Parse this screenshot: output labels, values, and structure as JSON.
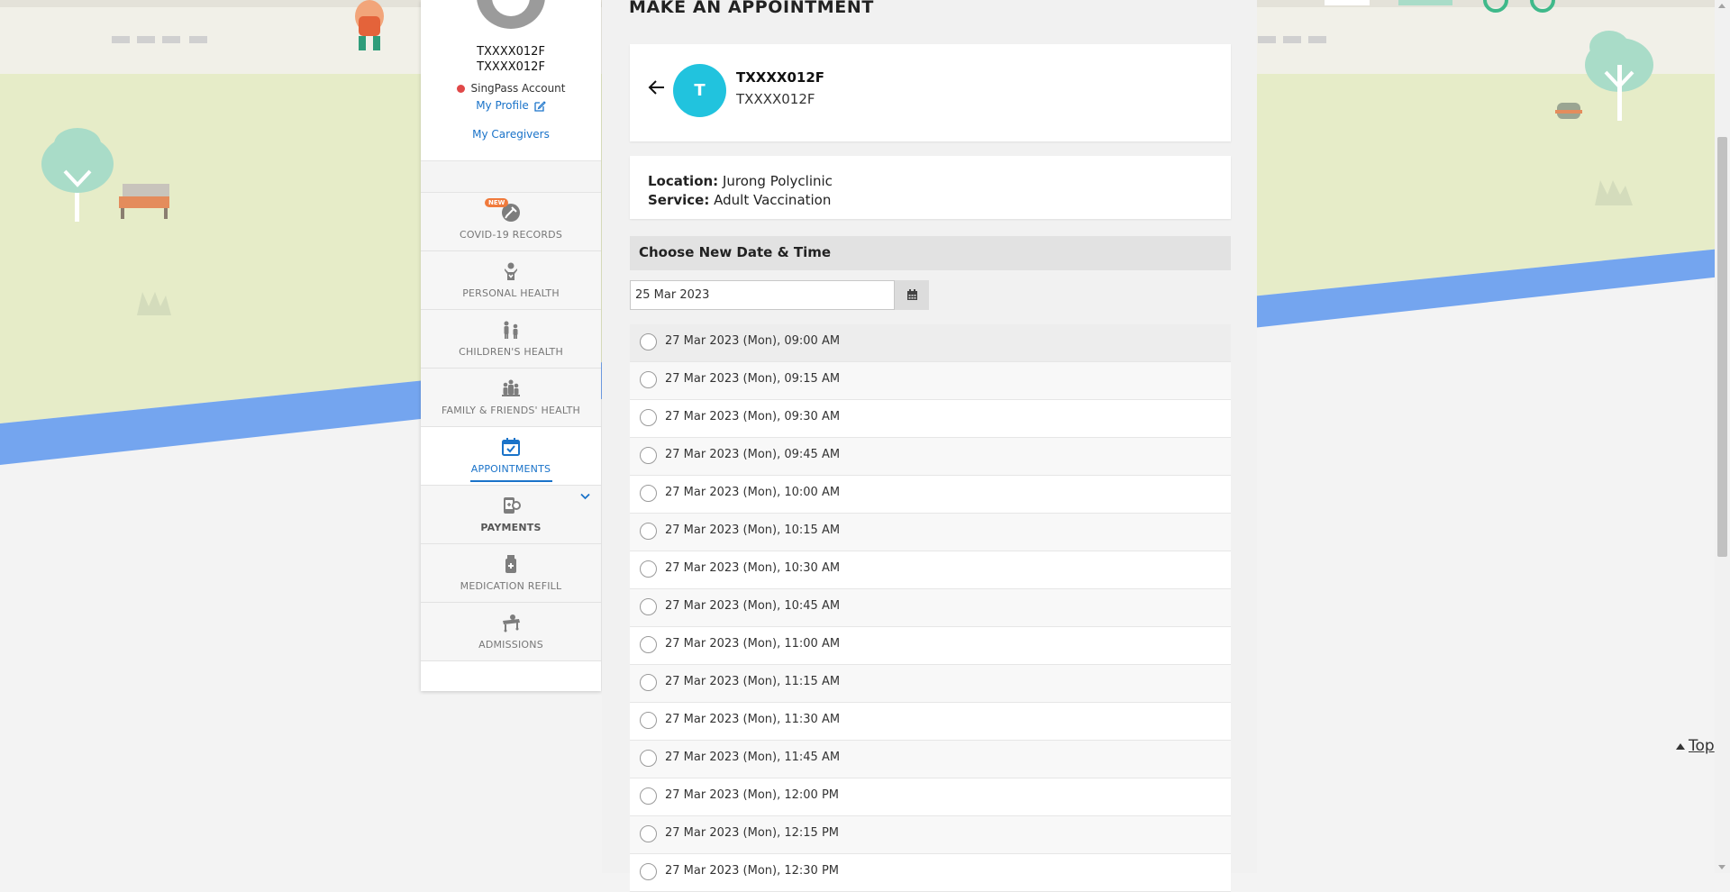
{
  "profile": {
    "id_line1": "TXXXX012F",
    "id_line2": "TXXXX012F",
    "account_type": "SingPass Account",
    "my_profile": "My Profile",
    "my_caregivers": "My Caregivers"
  },
  "nav": {
    "items": [
      {
        "label": "COVID-19 RECORDS",
        "icon": "syringe-shield-icon",
        "badge": "NEW"
      },
      {
        "label": "PERSONAL HEALTH",
        "icon": "person-heart-icon"
      },
      {
        "label": "CHILDREN'S HEALTH",
        "icon": "children-icon"
      },
      {
        "label": "FAMILY & FRIENDS' HEALTH",
        "icon": "family-icon"
      },
      {
        "label": "APPOINTMENTS",
        "icon": "calendar-check-icon",
        "active": true
      },
      {
        "label": "PAYMENTS",
        "icon": "payment-icon",
        "expandable": true
      },
      {
        "label": "MEDICATION REFILL",
        "icon": "medicine-bottle-icon"
      },
      {
        "label": "ADMISSIONS",
        "icon": "hospital-bed-icon"
      }
    ]
  },
  "main": {
    "title": "MAKE AN APPOINTMENT",
    "patient": {
      "initial": "T",
      "name": "TXXXX012F",
      "id": "TXXXX012F"
    },
    "info": {
      "location_label": "Location:",
      "location_value": "Jurong Polyclinic",
      "service_label": "Service:",
      "service_value": "Adult Vaccination"
    },
    "section_header": "Choose New Date & Time",
    "date_value": "25 Mar 2023",
    "slots": [
      "27 Mar 2023 (Mon), 09:00 AM",
      "27 Mar 2023 (Mon), 09:15 AM",
      "27 Mar 2023 (Mon), 09:30 AM",
      "27 Mar 2023 (Mon), 09:45 AM",
      "27 Mar 2023 (Mon), 10:00 AM",
      "27 Mar 2023 (Mon), 10:15 AM",
      "27 Mar 2023 (Mon), 10:30 AM",
      "27 Mar 2023 (Mon), 10:45 AM",
      "27 Mar 2023 (Mon), 11:00 AM",
      "27 Mar 2023 (Mon), 11:15 AM",
      "27 Mar 2023 (Mon), 11:30 AM",
      "27 Mar 2023 (Mon), 11:45 AM",
      "27 Mar 2023 (Mon), 12:00 PM",
      "27 Mar 2023 (Mon), 12:15 PM",
      "27 Mar 2023 (Mon), 12:30 PM"
    ]
  },
  "top_link": "Top",
  "colors": {
    "accent": "#1a73c9",
    "avatar": "#21c3de",
    "status_dot": "#e04848",
    "badge": "#f07a3c"
  }
}
